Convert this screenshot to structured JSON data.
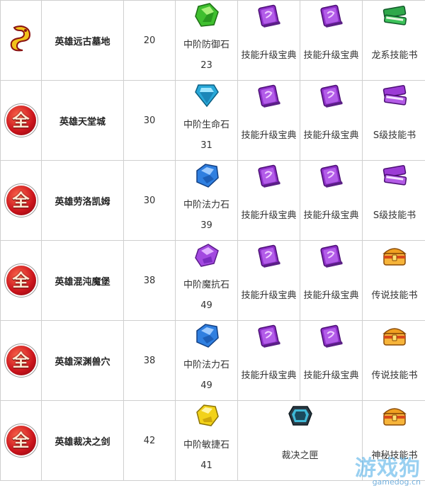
{
  "rows": [
    {
      "dungeon": "英雄远古墓地",
      "level": "20",
      "icon": "dragon-icon",
      "items": [
        {
          "icon": "green-gem-icon",
          "label": "中阶防御石",
          "count": "23"
        },
        {
          "icon": "purple-book-icon",
          "label": "技能升级宝典",
          "count": ""
        },
        {
          "icon": "purple-book-icon",
          "label": "技能升级宝典",
          "count": ""
        },
        {
          "icon": "green-book-icon",
          "label": "龙系技能书",
          "count": ""
        }
      ]
    },
    {
      "dungeon": "英雄天堂城",
      "level": "30",
      "icon": "quan-icon",
      "items": [
        {
          "icon": "cyan-gem-icon",
          "label": "中阶生命石",
          "count": "31"
        },
        {
          "icon": "purple-book-icon",
          "label": "技能升级宝典",
          "count": ""
        },
        {
          "icon": "purple-book-icon",
          "label": "技能升级宝典",
          "count": ""
        },
        {
          "icon": "purple-books-icon",
          "label": "S级技能书",
          "count": ""
        }
      ]
    },
    {
      "dungeon": "英雄劳洛凯姆",
      "level": "30",
      "icon": "quan-icon",
      "items": [
        {
          "icon": "blue-gem-icon",
          "label": "中阶法力石",
          "count": "39"
        },
        {
          "icon": "purple-book-icon",
          "label": "技能升级宝典",
          "count": ""
        },
        {
          "icon": "purple-book-icon",
          "label": "技能升级宝典",
          "count": ""
        },
        {
          "icon": "purple-books-icon",
          "label": "S级技能书",
          "count": ""
        }
      ]
    },
    {
      "dungeon": "英雄混沌魔堡",
      "level": "38",
      "icon": "quan-icon",
      "items": [
        {
          "icon": "violet-gem-icon",
          "label": "中阶魔抗石",
          "count": "49"
        },
        {
          "icon": "purple-book-icon",
          "label": "技能升级宝典",
          "count": ""
        },
        {
          "icon": "purple-book-icon",
          "label": "技能升级宝典",
          "count": ""
        },
        {
          "icon": "treasure-chest-icon",
          "label": "传说技能书",
          "count": ""
        }
      ]
    },
    {
      "dungeon": "英雄深渊兽穴",
      "level": "38",
      "icon": "quan-icon",
      "items": [
        {
          "icon": "blue-gem-icon",
          "label": "中阶法力石",
          "count": "49"
        },
        {
          "icon": "purple-book-icon",
          "label": "技能升级宝典",
          "count": ""
        },
        {
          "icon": "purple-book-icon",
          "label": "技能升级宝典",
          "count": ""
        },
        {
          "icon": "treasure-chest-icon",
          "label": "传说技能书",
          "count": ""
        }
      ]
    },
    {
      "dungeon": "英雄裁决之剑",
      "level": "42",
      "icon": "quan-icon",
      "items": [
        {
          "icon": "yellow-gem-icon",
          "label": "中阶敏捷石",
          "count": "41"
        },
        {
          "icon": "judgement-box-icon",
          "label": "裁决之匣",
          "count": "",
          "span": 2
        },
        {
          "icon": "treasure-chest-icon",
          "label": "神秘技能书",
          "count": ""
        }
      ]
    }
  ],
  "badge_text": "全",
  "watermark": {
    "main": "游戏狗",
    "sub": "gamedog.cn"
  },
  "colors": {
    "border": "#cfcfcf",
    "quan_red": "#c8121b",
    "text": "#333333"
  }
}
